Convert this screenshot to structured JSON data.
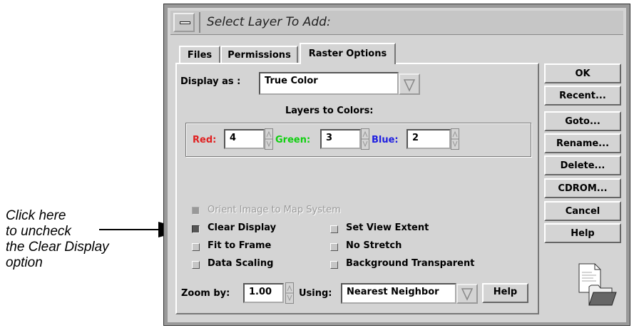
{
  "annotation": [
    "Click here",
    "to uncheck",
    "the Clear Display",
    "option"
  ],
  "window": {
    "title": "Select Layer To Add:"
  },
  "tabs": [
    "Files",
    "Permissions",
    "Raster Options"
  ],
  "display_as": {
    "label": "Display as :",
    "value": "True Color"
  },
  "layers_to_colors": {
    "label": "Layers to Colors:",
    "red": {
      "label": "Red:",
      "value": "4",
      "color": "#e02020"
    },
    "green": {
      "label": "Green:",
      "value": "3",
      "color": "#10d010"
    },
    "blue": {
      "label": "Blue:",
      "value": "2",
      "color": "#2020e0"
    }
  },
  "options": {
    "orient": {
      "label": "Orient Image to Map System",
      "checked": true,
      "disabled": true
    },
    "clear_display": {
      "label": "Clear Display",
      "checked": true
    },
    "set_view_extent": {
      "label": "Set View Extent",
      "checked": false
    },
    "fit_to_frame": {
      "label": "Fit to Frame",
      "checked": false
    },
    "no_stretch": {
      "label": "No Stretch",
      "checked": false
    },
    "data_scaling": {
      "label": "Data Scaling",
      "checked": false
    },
    "background_transparent": {
      "label": "Background Transparent",
      "checked": false
    }
  },
  "zoom": {
    "label": "Zoom by:",
    "value": "1.00",
    "using_label": "Using:",
    "using_value": "Nearest Neighbor",
    "help": "Help"
  },
  "side_buttons": [
    "OK",
    "Recent...",
    "Goto...",
    "Rename...",
    "Delete...",
    "CDROM...",
    "Cancel",
    "Help"
  ],
  "icons": {
    "preview": "file-folder-icon",
    "window_menu": "window-menu-icon"
  }
}
